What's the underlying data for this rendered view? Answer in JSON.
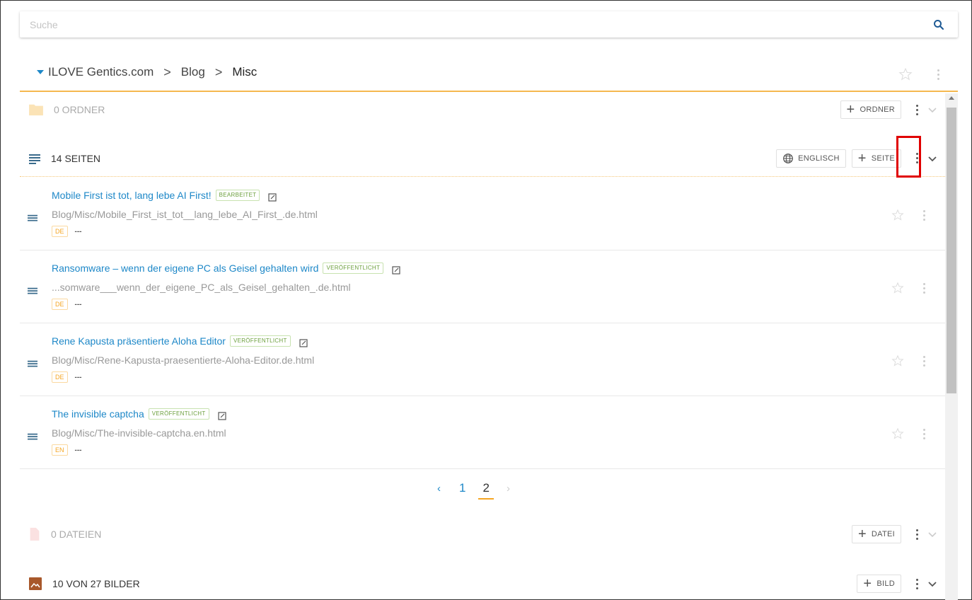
{
  "search": {
    "placeholder": "Suche"
  },
  "breadcrumb": {
    "items": [
      "ILOVE Gentics.com",
      "Blog"
    ],
    "current": "Misc",
    "separator": ">"
  },
  "sections": {
    "folders": {
      "title": "0 ORDNER",
      "add_label": "ORDNER"
    },
    "pages": {
      "title": "14 SEITEN",
      "language_label": "ENGLISCH",
      "add_label": "SEITE"
    },
    "files": {
      "title": "0 DATEIEN",
      "add_label": "DATEI"
    },
    "images": {
      "title": "10 VON 27 BILDER",
      "add_label": "BILD"
    }
  },
  "pages": [
    {
      "title": "Mobile First ist tot, lang lebe AI First!",
      "status": "BEARBEITET",
      "path": "Blog/Misc/Mobile_First_ist_tot__lang_lebe_AI_First_.de.html",
      "lang": "DE",
      "more": "---"
    },
    {
      "title": "Ransomware – wenn der eigene PC als Geisel gehalten wird",
      "status": "VERÖFFENTLICHT",
      "path": "...somware___wenn_der_eigene_PC_als_Geisel_gehalten_.de.html",
      "lang": "DE",
      "more": "---"
    },
    {
      "title": "Rene Kapusta präsentierte Aloha Editor",
      "status": "VERÖFFENTLICHT",
      "path": "Blog/Misc/Rene-Kapusta-praesentierte-Aloha-Editor.de.html",
      "lang": "DE",
      "more": "---"
    },
    {
      "title": "The invisible captcha",
      "status": "VERÖFFENTLICHT",
      "path": "Blog/Misc/The-invisible-captcha.en.html",
      "lang": "EN",
      "more": "---"
    }
  ],
  "pagination": {
    "prev": "‹",
    "pages": [
      "1",
      "2"
    ],
    "current": "2",
    "next": "›"
  },
  "colors": {
    "accent": "#1e88c8",
    "highlight": "#f5a623",
    "published": "#6b9f3c",
    "annotation": "#e00000"
  }
}
